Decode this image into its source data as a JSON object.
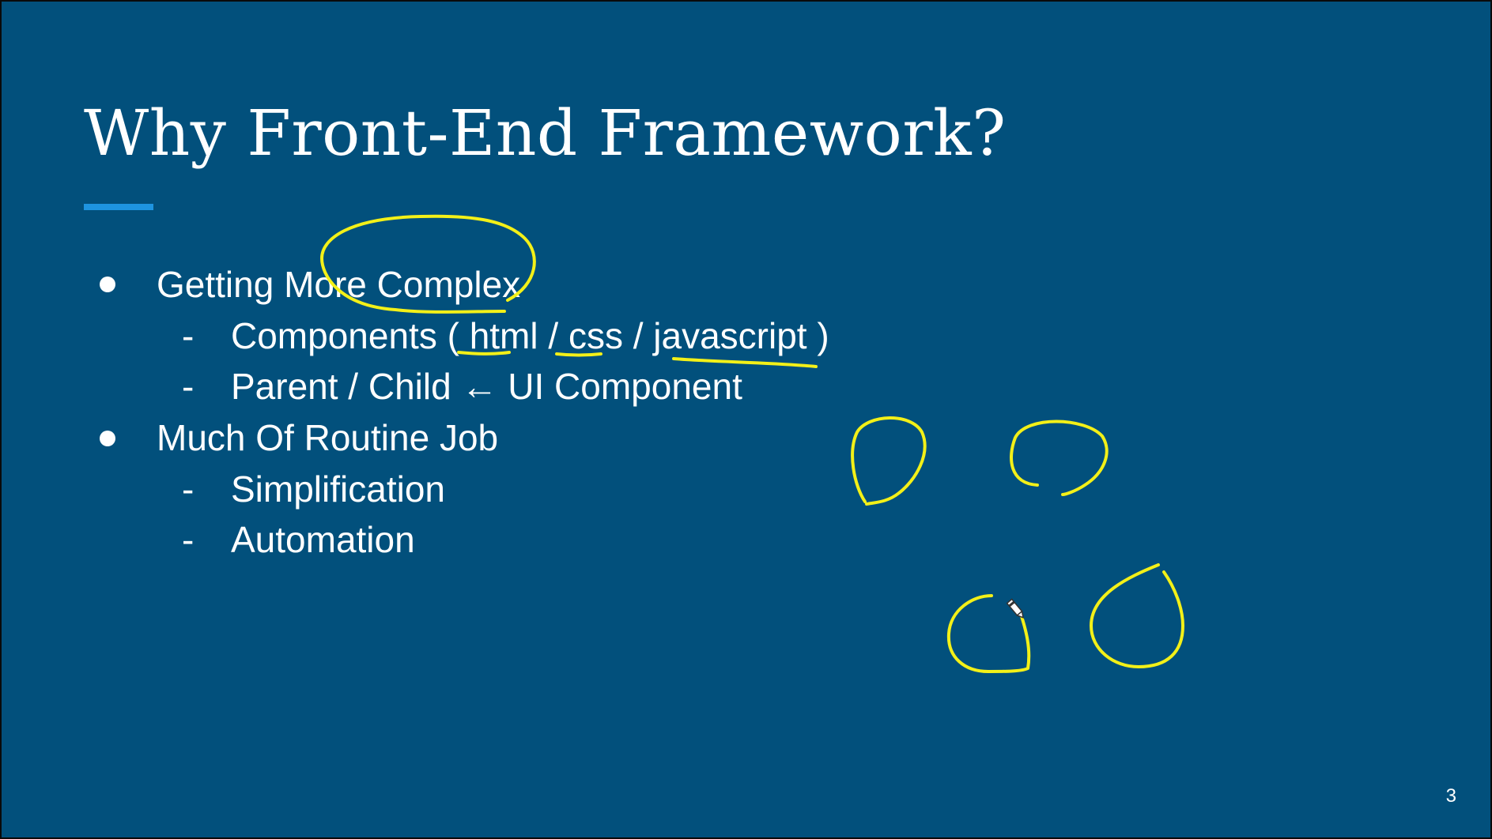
{
  "slide": {
    "title": "Why Front-End Framework?",
    "page_number": "3",
    "colors": {
      "background": "#02507c",
      "accent": "#1e94e0",
      "text": "#ffffff",
      "annotation": "#f3f018"
    },
    "bullets": [
      {
        "text": "Getting More Complex",
        "sub": [
          "Components ( html / css /  javascript )",
          "Parent / Child ← UI Component"
        ]
      },
      {
        "text": "Much Of Routine Job",
        "sub": [
          "Simplification",
          "Automation"
        ]
      }
    ],
    "sub_marker": "-"
  },
  "annotations": {
    "tool": "pen-cursor-icon",
    "shapes": [
      "circle-around-more-complex",
      "underline-html",
      "underline-css",
      "underline-javascript",
      "component-circle-1",
      "component-circle-2",
      "component-circle-3",
      "component-circle-4"
    ]
  }
}
